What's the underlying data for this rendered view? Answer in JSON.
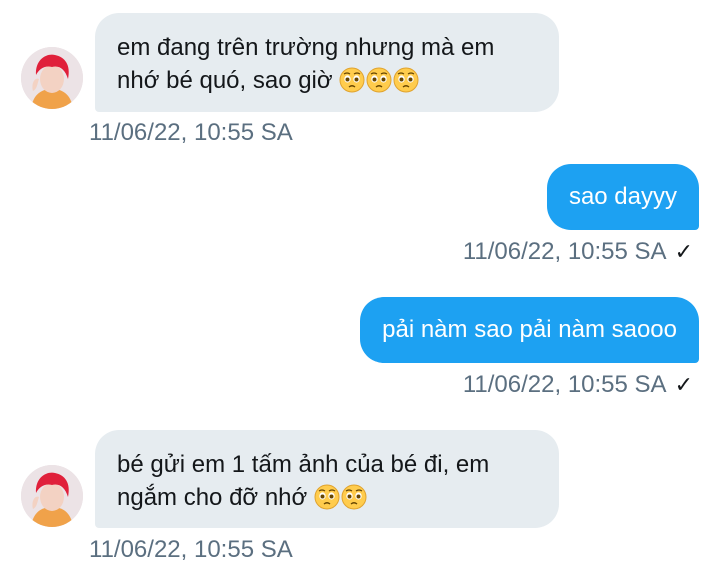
{
  "conversation": {
    "messages": [
      {
        "direction": "incoming",
        "lines": [
          "em đang trên trường nhưng mà em",
          "nhớ bé quó, sao giờ"
        ],
        "emoji_icons": [
          "pleading-face-icon",
          "pleading-face-icon",
          "pleading-face-icon"
        ],
        "timestamp": "11/06/22, 10:55 SA"
      },
      {
        "direction": "outgoing",
        "text": "sao dayyy",
        "timestamp": "11/06/22, 10:55 SA",
        "status_icon": "✓"
      },
      {
        "direction": "outgoing",
        "text": "pải nàm sao pải nàm saooo",
        "timestamp": "11/06/22, 10:55 SA",
        "status_icon": "✓"
      },
      {
        "direction": "incoming",
        "lines": [
          "bé gửi em 1 tấm ảnh của bé đi, em",
          "ngắm cho đỡ nhớ"
        ],
        "emoji_icons": [
          "pleading-face-icon",
          "pleading-face-icon"
        ],
        "timestamp": "11/06/22, 10:55 SA"
      }
    ]
  },
  "colors": {
    "incoming_bubble": "#e6ecf0",
    "outgoing_bubble": "#1da1f2",
    "timestamp_text": "#5b6f80",
    "background": "#ffffff"
  }
}
